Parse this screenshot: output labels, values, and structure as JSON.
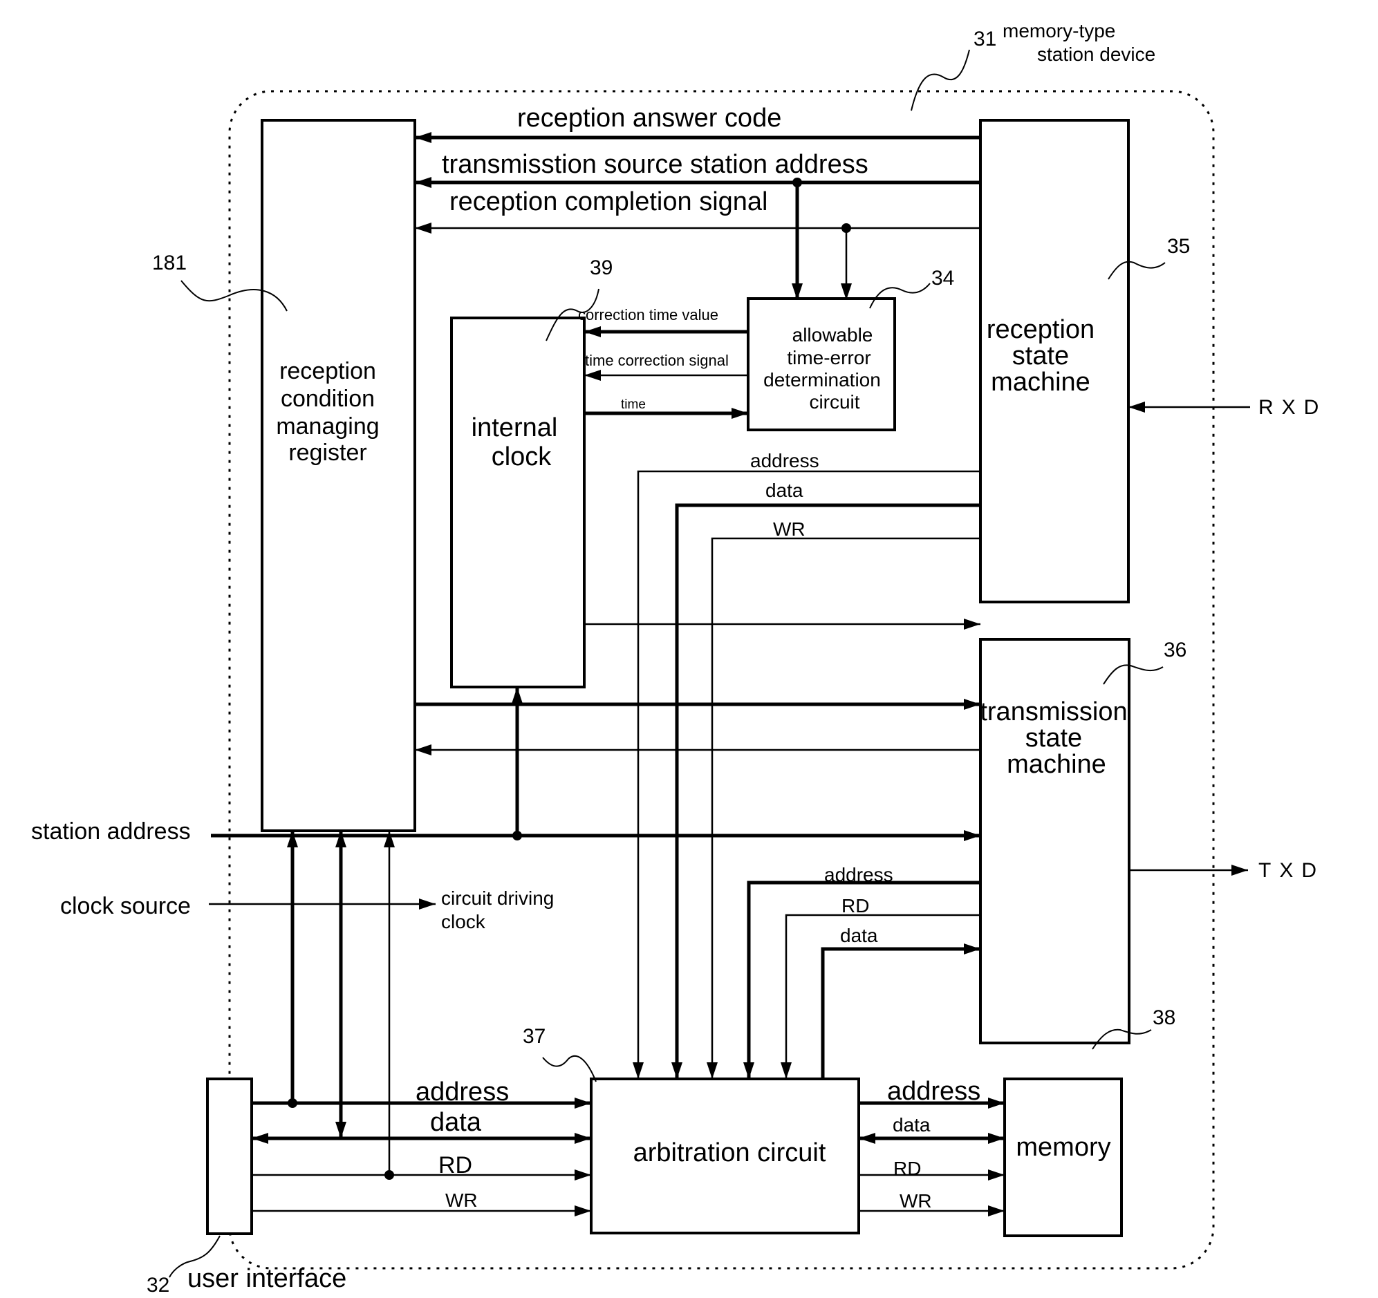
{
  "device": {
    "ref": "31",
    "title_line1": "memory-type",
    "title_line2": "station device"
  },
  "blocks": {
    "register": {
      "ref": "181",
      "lines": [
        "reception",
        "condition",
        "managing",
        "register"
      ]
    },
    "internal_clock": {
      "ref": "39",
      "lines": [
        "internal",
        "clock"
      ]
    },
    "time_error": {
      "ref": "34",
      "lines": [
        "allowable",
        "time-error",
        "determination",
        "circuit"
      ]
    },
    "rx_sm": {
      "ref": "35",
      "lines": [
        "reception",
        "state",
        "machine"
      ]
    },
    "tx_sm": {
      "ref": "36",
      "lines": [
        "transmission",
        "state",
        "machine"
      ]
    },
    "arbitration": {
      "ref": "37",
      "label": "arbitration circuit"
    },
    "memory": {
      "ref": "38",
      "label": "memory"
    },
    "user_interface": {
      "ref": "32",
      "label": "user interface"
    }
  },
  "signals": {
    "answer_code": "reception answer code",
    "source_address": "transmisstion source station address",
    "completion": "reception completion signal",
    "correction_value": "correction time value",
    "correction_signal": "time correction signal",
    "time": "time",
    "rx_address": "address",
    "rx_data": "data",
    "rx_wr": "WR",
    "tx_address": "address",
    "tx_rd": "RD",
    "tx_data": "data",
    "station_address": "station address",
    "clock_source": "clock source",
    "driving_clock_1": "circuit driving",
    "driving_clock_2": "clock",
    "ui_address": "address",
    "ui_data": "data",
    "ui_rd": "RD",
    "ui_wr": "WR",
    "mem_address": "address",
    "mem_data": "data",
    "mem_rd": "RD",
    "mem_wr": "WR",
    "rxd": "RXD",
    "txd": "TXD"
  }
}
